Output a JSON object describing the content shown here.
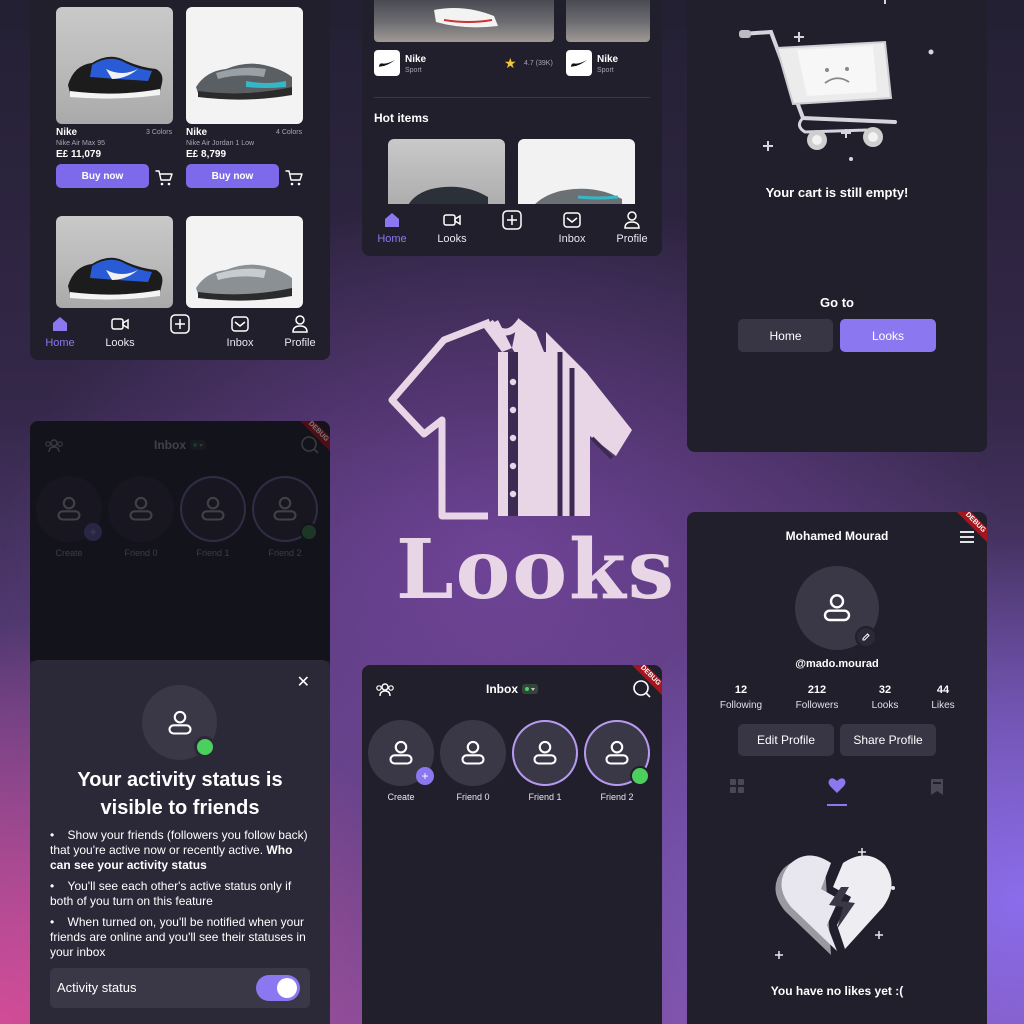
{
  "colors": {
    "accent": "#7c6aeb",
    "panel": "#211f2b",
    "online": "#4bd05d",
    "badge": "#a3161e"
  },
  "nav": {
    "home": "Home",
    "looks": "Looks",
    "inbox": "Inbox",
    "profile": "Profile"
  },
  "shop": {
    "products": [
      {
        "brand": "Nike",
        "colors": "3 Colors",
        "model": "Nike Air Max 95",
        "price": "E£ 11,079",
        "buy": "Buy now"
      },
      {
        "brand": "Nike",
        "colors": "4 Colors",
        "model": "Nike Air Jordan 1 Low",
        "price": "E£ 8,799",
        "buy": "Buy now"
      }
    ]
  },
  "feed": {
    "cards": [
      {
        "brand": "Nike",
        "category": "Sport",
        "rating": "4.7 (39K)"
      },
      {
        "brand": "Nike",
        "category": "Sport"
      }
    ],
    "hot_items_title": "Hot items"
  },
  "cart": {
    "empty_message": "Your cart is still empty!",
    "goto_label": "Go to",
    "home_button": "Home",
    "looks_button": "Looks"
  },
  "logo": {
    "text": "Looks"
  },
  "inbox": {
    "title": "Inbox",
    "create": "Create",
    "friends": [
      "Friend 0",
      "Friend 1",
      "Friend 2"
    ],
    "debug": "DEBUG"
  },
  "activity_sheet": {
    "heading": "Your activity status is visible to friends",
    "bullet1_a": "Show your friends (followers you follow back) that you're active now or recently active. ",
    "bullet1_b": "Who can see your activity status",
    "bullet2": "You'll see each other's active status only if both of you turn on this feature",
    "bullet3": "When turned on, you'll be notified when your friends are online and you'll see their statuses in your inbox",
    "toggle_label": "Activity status",
    "toggle_on": true
  },
  "profile": {
    "name": "Mohamed Mourad",
    "handle": "@mado.mourad",
    "stats": [
      {
        "value": "12",
        "label": "Following"
      },
      {
        "value": "212",
        "label": "Followers"
      },
      {
        "value": "32",
        "label": "Looks"
      },
      {
        "value": "44",
        "label": "Likes"
      }
    ],
    "edit_button": "Edit Profile",
    "share_button": "Share Profile",
    "empty_likes": "You have no likes yet :("
  }
}
